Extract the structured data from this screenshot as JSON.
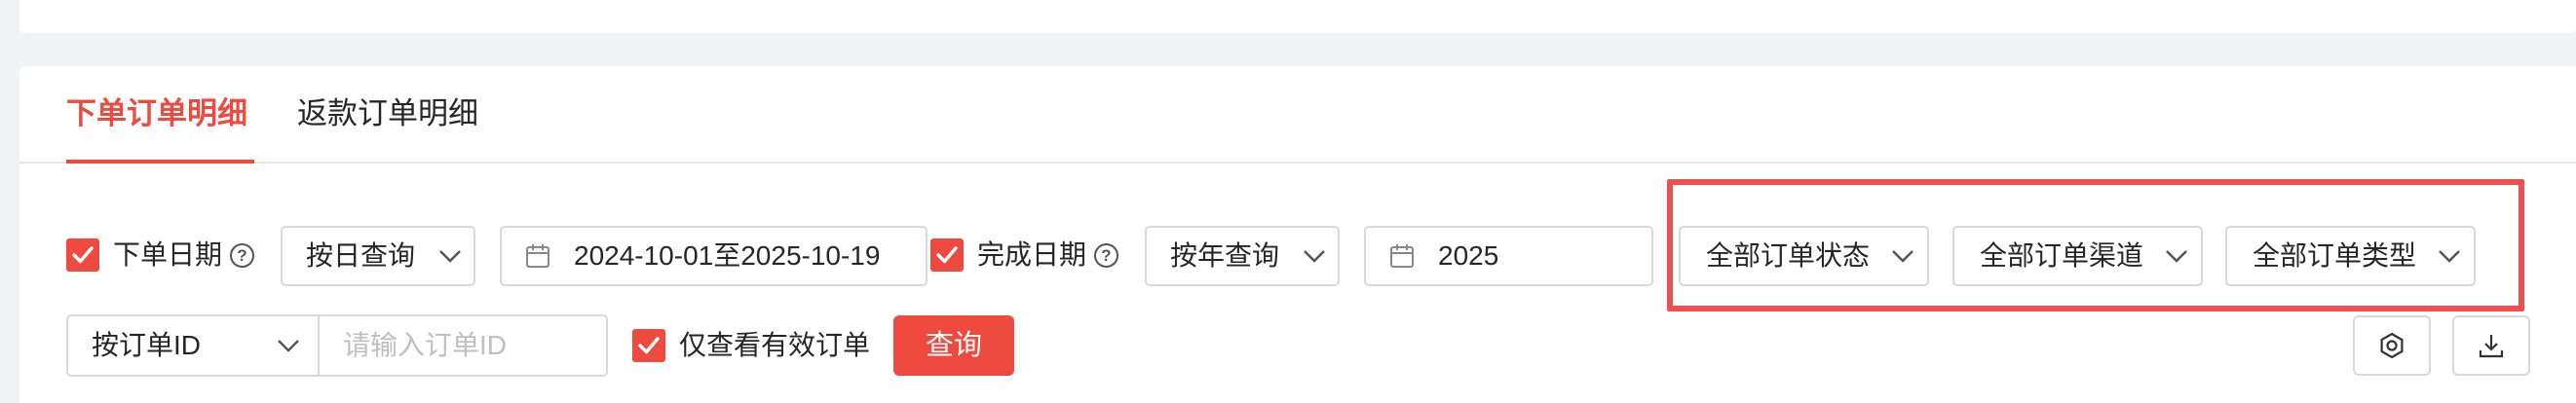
{
  "tabs": [
    {
      "label": "下单订单明细",
      "active": true
    },
    {
      "label": "返款订单明细",
      "active": false
    }
  ],
  "filters": {
    "order_date": {
      "checked": true,
      "label": "下单日期",
      "mode_value": "按日查询",
      "range_value": "2024-10-01至2025-10-19"
    },
    "finish_date": {
      "checked": true,
      "label": "完成日期",
      "mode_value": "按年查询",
      "year_value": "2025"
    },
    "status_select": "全部订单状态",
    "channel_select": "全部订单渠道",
    "type_select": "全部订单类型",
    "id_type_select": "按订单ID",
    "id_input": {
      "value": "",
      "placeholder": "请输入订单ID"
    },
    "valid_only": {
      "checked": true,
      "label": "仅查看有效订单"
    },
    "query_button": "查询"
  },
  "icons": {
    "help": "question-circle-icon",
    "calendar": "calendar-icon",
    "settings": "hexagon-settings-icon",
    "download": "download-icon"
  },
  "colors": {
    "accent": "#ee4a3f",
    "highlight_border": "#ef4f4f"
  }
}
